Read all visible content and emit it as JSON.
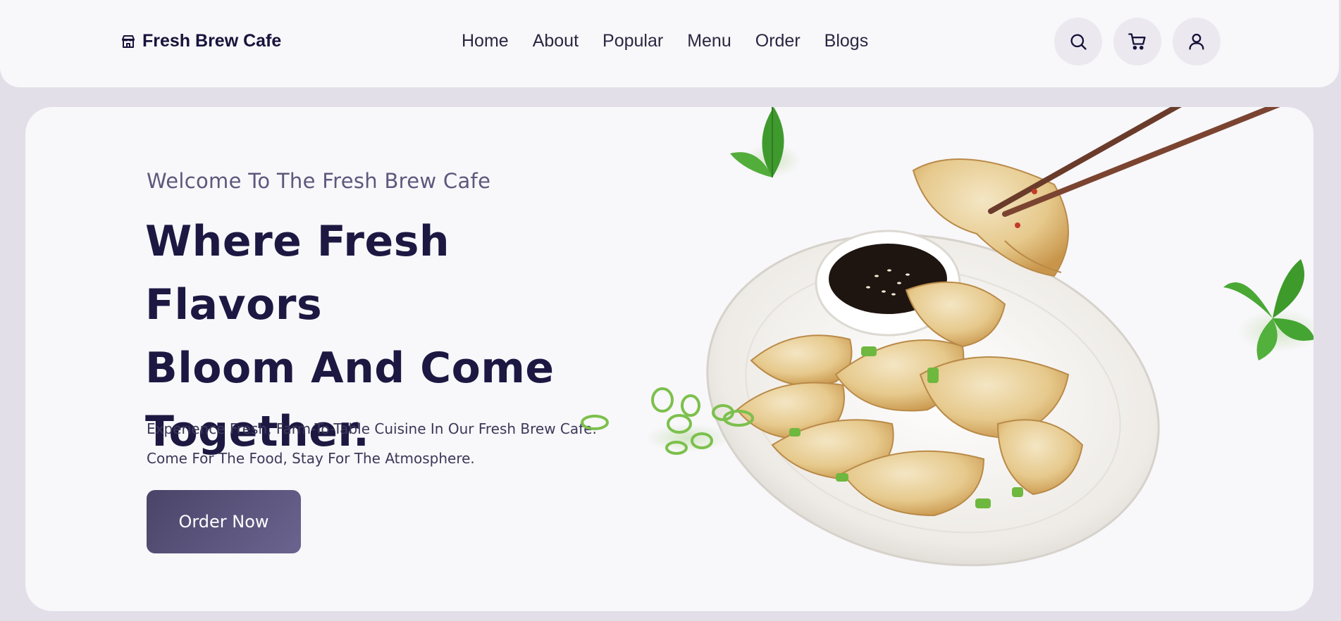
{
  "brand": {
    "name": "Fresh Brew Cafe",
    "icon": "store-icon"
  },
  "nav": {
    "links": [
      "Home",
      "About",
      "Popular",
      "Menu",
      "Order",
      "Blogs"
    ]
  },
  "actions": {
    "search_icon": "search-icon",
    "cart_icon": "cart-icon",
    "user_icon": "user-icon"
  },
  "hero": {
    "welcome": "Welcome To The Fresh Brew Cafe",
    "headline_lines": [
      "Where Fresh Flavors",
      "Bloom And Come",
      "Together."
    ],
    "description_lines": [
      "Experience Fresh, Farm-To-Table Cuisine In Our Fresh Brew Cafe.",
      "Come For The Food, Stay For The Atmosphere."
    ],
    "cta_label": "Order Now"
  },
  "colors": {
    "page_bg": "#e2dfe8",
    "surface": "#f8f7fa",
    "heading": "#1c1842",
    "accent": "#5a5380"
  }
}
